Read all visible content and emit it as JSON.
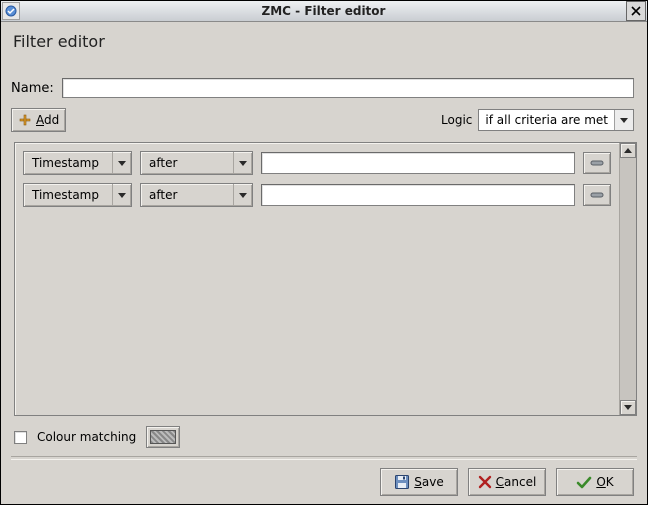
{
  "window": {
    "title": "ZMC - Filter editor"
  },
  "page": {
    "heading": "Filter editor",
    "name_label": "Name:",
    "name_value": ""
  },
  "toolbar": {
    "add_label": "Add",
    "logic_label": "Logic",
    "logic_value": "if all criteria are met"
  },
  "criteria": [
    {
      "field": "Timestamp",
      "operator": "after",
      "value": ""
    },
    {
      "field": "Timestamp",
      "operator": "after",
      "value": ""
    }
  ],
  "colour": {
    "label": "Colour matching",
    "checked": false
  },
  "buttons": {
    "save": "Save",
    "cancel": "Cancel",
    "ok": "OK"
  },
  "mnemonics": {
    "add": "A",
    "save": "S",
    "cancel": "C",
    "ok": "O"
  }
}
